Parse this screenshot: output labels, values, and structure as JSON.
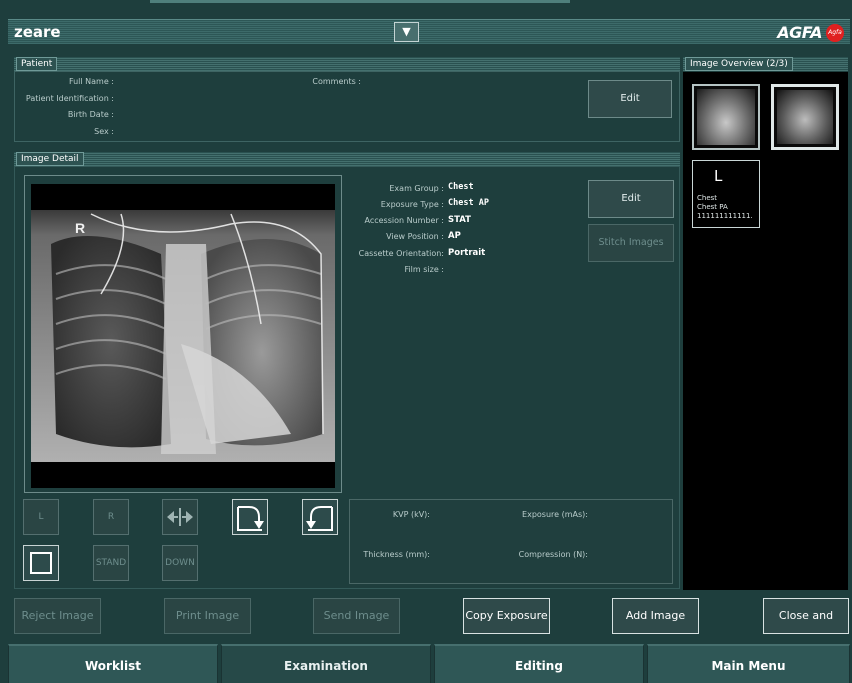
{
  "header": {
    "title": "zeare",
    "brand": "AGFA",
    "brand_mark": "Agfa"
  },
  "patient": {
    "section_label": "Patient",
    "labels": {
      "full_name": "Full Name :",
      "patient_id": "Patient Identification :",
      "birth_date": "Birth Date :",
      "sex": "Sex :",
      "comments": "Comments :"
    },
    "edit_label": "Edit"
  },
  "image_detail": {
    "section_label": "Image Detail",
    "labels": {
      "exam_group": "Exam Group :",
      "exposure_type": "Exposure Type :",
      "accession_number": "Accession Number :",
      "view_position": "View Position :",
      "cassette_orientation": "Cassette Orientation:",
      "film_size": "Film size :"
    },
    "values": {
      "exam_group": "Chest",
      "exposure_type": "Chest AP",
      "accession_number": "STAT",
      "view_position": "AP",
      "cassette_orientation": "Portrait",
      "film_size": ""
    },
    "edit_label": "Edit",
    "stitch_label": "Stitch Images",
    "xray_marker": "R"
  },
  "controls": {
    "left": "L",
    "right": "R",
    "stand": "STAND",
    "down": "DOWN"
  },
  "exposure": {
    "kvp_label": "KVP (kV):",
    "exposure_label": "Exposure (mAs):",
    "thickness_label": "Thickness (mm):",
    "compression_label": "Compression (N):"
  },
  "overview": {
    "section_label": "Image Overview (2/3)",
    "card": {
      "icon": "L",
      "line1": "Chest",
      "line2": "Chest PA",
      "line3": "111111111111."
    }
  },
  "actions": {
    "reject": "Reject Image",
    "print": "Print Image",
    "send": "Send Image",
    "copy": "Copy Exposure",
    "add": "Add Image",
    "close_send": "Close and Send"
  },
  "nav": {
    "worklist": "Worklist",
    "examination": "Examination",
    "editing": "Editing",
    "main_menu": "Main Menu"
  },
  "colors": {
    "background": "#1e3e3d",
    "panel_border": "#3e6463",
    "brand_red": "#e02020",
    "disabled_text": "#6e8e8d"
  }
}
